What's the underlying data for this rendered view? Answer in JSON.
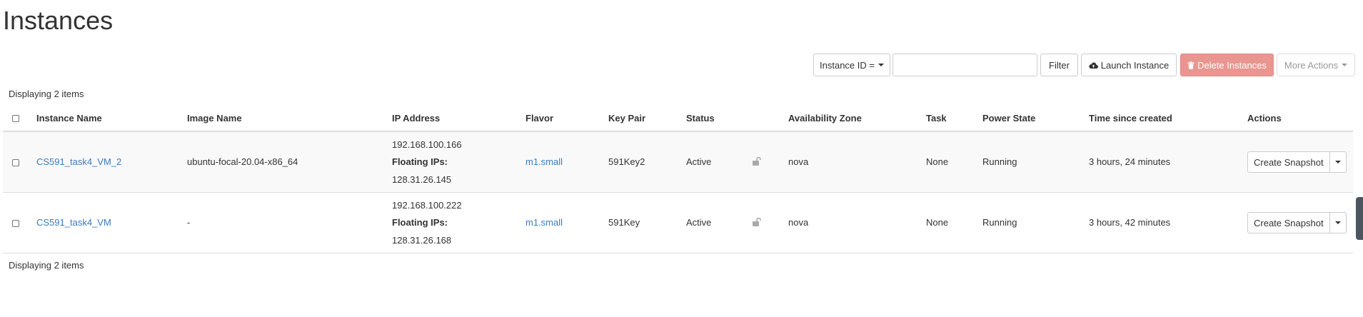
{
  "page": {
    "title": "Instances"
  },
  "toolbar": {
    "filter_field_label": "Instance ID =",
    "search_value": "",
    "filter_label": "Filter",
    "launch_label": "Launch Instance",
    "delete_label": "Delete Instances",
    "more_label": "More Actions"
  },
  "table": {
    "count_top": "Displaying 2 items",
    "count_bottom": "Displaying 2 items",
    "columns": {
      "name": "Instance Name",
      "image": "Image Name",
      "ip": "IP Address",
      "flavor": "Flavor",
      "keypair": "Key Pair",
      "status": "Status",
      "az": "Availability Zone",
      "task": "Task",
      "power": "Power State",
      "age": "Time since created",
      "actions": "Actions"
    },
    "rows": [
      {
        "name": "CS591_task4_VM_2",
        "image": "ubuntu-focal-20.04-x86_64",
        "ip": "192.168.100.166",
        "floating_label": "Floating IPs:",
        "floating_ip": "128.31.26.145",
        "flavor": "m1.small",
        "keypair": "591Key2",
        "status": "Active",
        "az": "nova",
        "task": "None",
        "power": "Running",
        "age": "3 hours, 24 minutes",
        "action": "Create Snapshot"
      },
      {
        "name": "CS591_task4_VM",
        "image": "-",
        "ip": "192.168.100.222",
        "floating_label": "Floating IPs:",
        "floating_ip": "128.31.26.168",
        "flavor": "m1.small",
        "keypair": "591Key",
        "status": "Active",
        "az": "nova",
        "task": "None",
        "power": "Running",
        "age": "3 hours, 42 minutes",
        "action": "Create Snapshot"
      }
    ]
  },
  "colors": {
    "link": "#3a7bbf",
    "danger": "#e8968f",
    "border": "#dddddd"
  },
  "icons": {
    "launch": "cloud-upload-icon",
    "delete": "trash-icon",
    "lock": "unlock-icon"
  }
}
